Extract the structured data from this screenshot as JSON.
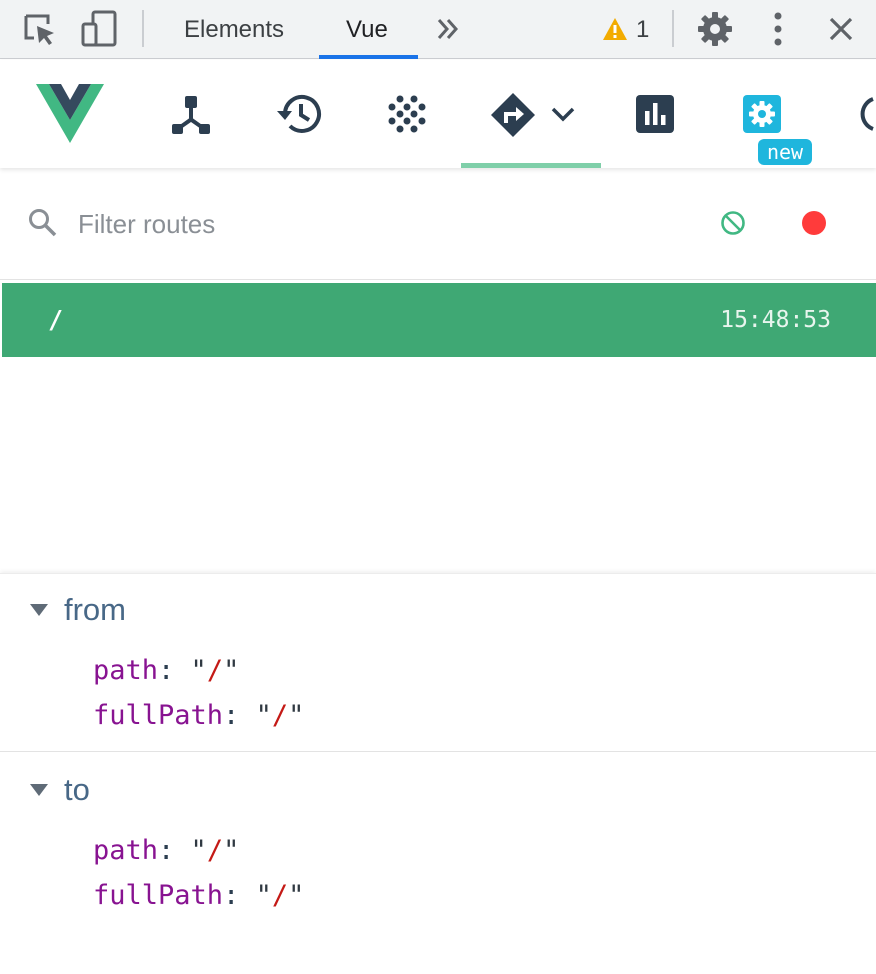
{
  "devtools": {
    "tabs": [
      {
        "label": "Elements",
        "active": false
      },
      {
        "label": "Vue",
        "active": true
      }
    ],
    "warning_count": "1",
    "icons": [
      "inspect-element-icon",
      "device-toggle-icon",
      "more-tabs-icon",
      "warning-icon",
      "settings-icon",
      "more-options-icon",
      "close-icon"
    ]
  },
  "vue_toolbar": {
    "items": [
      {
        "name": "components",
        "icon": "component-tree-icon"
      },
      {
        "name": "timeline",
        "icon": "history-icon"
      },
      {
        "name": "vuex",
        "icon": "dots-grid-icon"
      },
      {
        "name": "router",
        "icon": "route-sign-icon",
        "active": true
      },
      {
        "name": "performance",
        "icon": "bar-chart-icon"
      },
      {
        "name": "settings",
        "icon": "gear-icon"
      }
    ],
    "badge": "new",
    "accent_color": "#41b883"
  },
  "filter": {
    "placeholder": "Filter routes",
    "value": ""
  },
  "routes": [
    {
      "path": "/",
      "time": "15:48:53",
      "selected": true
    }
  ],
  "detail": {
    "sections": [
      {
        "title": "from",
        "props": [
          {
            "key": "path",
            "value": "/"
          },
          {
            "key": "fullPath",
            "value": "/"
          }
        ]
      },
      {
        "title": "to",
        "props": [
          {
            "key": "path",
            "value": "/"
          },
          {
            "key": "fullPath",
            "value": "/"
          }
        ]
      }
    ]
  },
  "colors": {
    "route_row_bg": "#3fa874",
    "recording_dot": "#ff3b3b",
    "tab_underline": "#1a73e8"
  }
}
